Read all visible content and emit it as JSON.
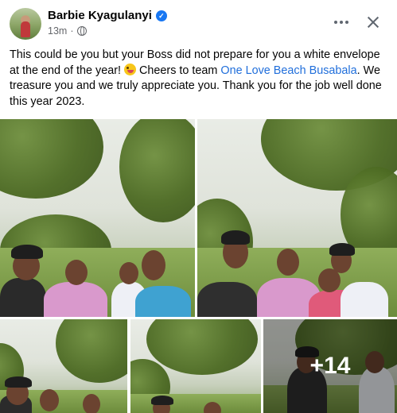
{
  "post": {
    "author": "Barbie Kyagulanyi",
    "verified_icon": "verified-badge-icon",
    "time": "13m",
    "separator": "·",
    "privacy_icon": "globe-icon",
    "text_before_emoji": "This could be you but your Boss did not prepare for you a white envelope at the end of the year!",
    "emoji_icon": "winking-face-with-tongue-emoji",
    "text_after_emoji": "Cheers to team",
    "link_text": "One Love Beach Busabala",
    "text_after_link": ". We treasure you and we truly appreciate you. Thank you for the job well done this year 2023.",
    "more_photos_label": "+14"
  },
  "colors": {
    "link": "#216fdb",
    "verified": "#1877f2",
    "meta": "#65676b"
  },
  "photos": [
    {
      "name": "photo-1"
    },
    {
      "name": "photo-2"
    },
    {
      "name": "photo-3"
    },
    {
      "name": "photo-4"
    },
    {
      "name": "photo-5"
    }
  ]
}
